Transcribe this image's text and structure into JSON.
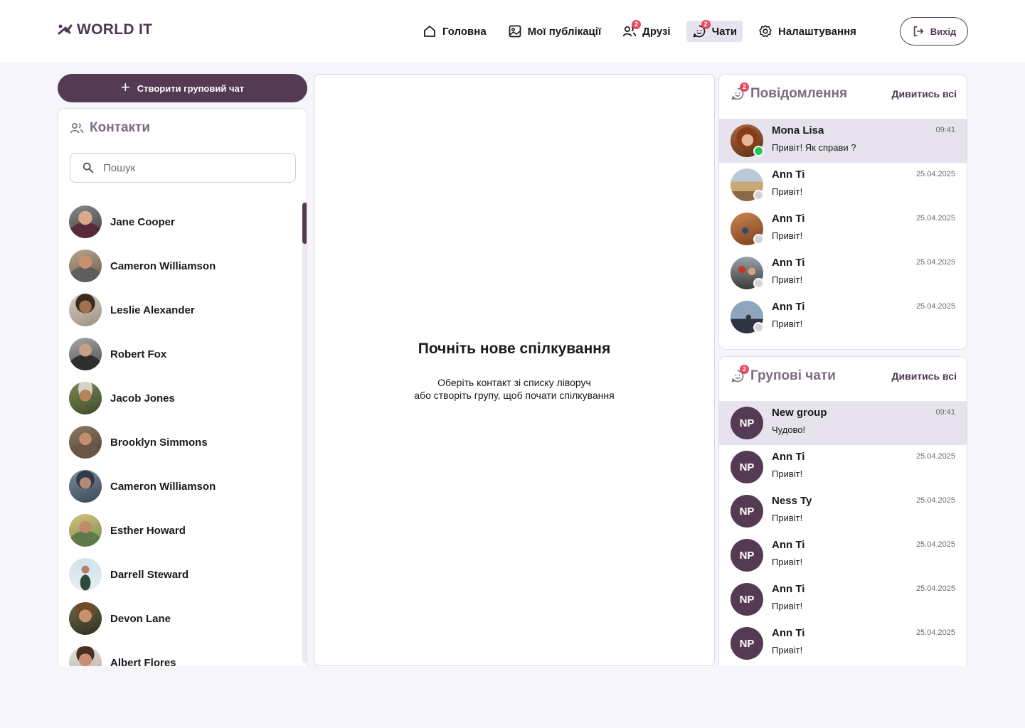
{
  "app": {
    "logo_text": "WORLD IT"
  },
  "nav": {
    "items": [
      {
        "label": "Головна",
        "icon": "home-icon"
      },
      {
        "label": "Мої публікації",
        "icon": "image-icon"
      },
      {
        "label": "Друзі",
        "icon": "friends-icon",
        "badge": "2"
      },
      {
        "label": "Чати",
        "icon": "chat-icon",
        "badge": "2",
        "active": true
      },
      {
        "label": "Налаштування",
        "icon": "gear-icon"
      }
    ],
    "logout_label": "Вихід"
  },
  "sidebar": {
    "create_group_label": "Створити груповий чат",
    "contacts_title": "Контакти",
    "search_placeholder": "Пошук",
    "contacts": [
      {
        "name": "Jane Cooper"
      },
      {
        "name": "Cameron Williamson"
      },
      {
        "name": "Leslie Alexander"
      },
      {
        "name": "Robert Fox"
      },
      {
        "name": "Jacob Jones"
      },
      {
        "name": "Brooklyn Simmons"
      },
      {
        "name": "Cameron Williamson"
      },
      {
        "name": "Esther Howard"
      },
      {
        "name": "Darrell Steward"
      },
      {
        "name": "Devon Lane"
      },
      {
        "name": "Albert Flores"
      }
    ]
  },
  "main": {
    "empty_title": "Почніть нове спілкування",
    "empty_line1": "Оберіть контакт зі списку ліворуч",
    "empty_line2": "або створіть групу, щоб почати спілкування"
  },
  "messages": {
    "title": "Повідомлення",
    "badge": "2",
    "see_all": "Дивитись всі",
    "items": [
      {
        "name": "Mona Lisa",
        "text": "Привіт! Як справи ?",
        "time": "09:41",
        "online": true
      },
      {
        "name": "Ann Ti",
        "text": "Привіт!",
        "time": "25.04.2025",
        "online": false
      },
      {
        "name": "Ann Ti",
        "text": "Привіт!",
        "time": "25.04.2025",
        "online": false
      },
      {
        "name": "Ann Ti",
        "text": "Привіт!",
        "time": "25.04.2025",
        "online": false
      },
      {
        "name": "Ann Ti",
        "text": "Привіт!",
        "time": "25.04.2025",
        "online": false
      }
    ]
  },
  "groups": {
    "title": "Групові чати",
    "badge": "2",
    "see_all": "Дивитись всі",
    "items": [
      {
        "initials": "NP",
        "name": "New group",
        "text": "Чудово!",
        "time": "09:41"
      },
      {
        "initials": "NP",
        "name": "Ann Ti",
        "text": "Привіт!",
        "time": "25.04.2025"
      },
      {
        "initials": "NP",
        "name": "Ness Ty",
        "text": "Привіт!",
        "time": "25.04.2025"
      },
      {
        "initials": "NP",
        "name": "Ann Ti",
        "text": "Привіт!",
        "time": "25.04.2025"
      },
      {
        "initials": "NP",
        "name": "Ann Ti",
        "text": "Привіт!",
        "time": "25.04.2025"
      },
      {
        "initials": "NP",
        "name": "Ann Ti",
        "text": "Привіт!",
        "time": "25.04.2025"
      }
    ]
  },
  "colors": {
    "brand": "#543b53",
    "badge": "#e84a5f",
    "online": "#22c55e",
    "offline": "#d4d4d8",
    "active_row": "#e7e3ee"
  }
}
